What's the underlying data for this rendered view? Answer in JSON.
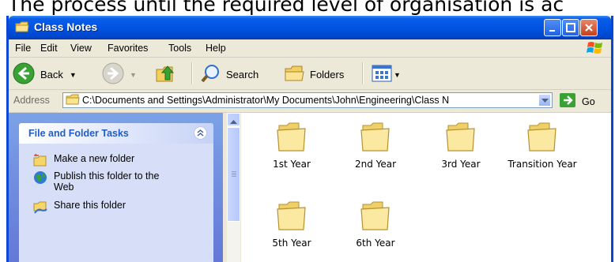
{
  "caption": "The process until the required level of organisation is ac",
  "window": {
    "title": "Class Notes",
    "colors": {
      "titlebar": "#0054e3",
      "taskpane": "#6f8ee0",
      "accent": "#215dc6"
    }
  },
  "menubar": {
    "items": [
      "File",
      "Edit",
      "View",
      "Favorites",
      "Tools",
      "Help"
    ]
  },
  "toolbar": {
    "back_label": "Back",
    "search_label": "Search",
    "folders_label": "Folders"
  },
  "address": {
    "label": "Address",
    "path": "C:\\Documents and Settings\\Administrator\\My Documents\\John\\Engineering\\Class N",
    "go_label": "Go"
  },
  "tasks": {
    "title": "File and Folder Tasks",
    "items": [
      {
        "label": "Make a new folder",
        "icon": "new-folder-icon"
      },
      {
        "label": "Publish this folder to the Web",
        "icon": "publish-web-icon"
      },
      {
        "label": "Share this folder",
        "icon": "share-folder-icon"
      }
    ]
  },
  "folders": [
    {
      "name": "1st Year"
    },
    {
      "name": "2nd Year"
    },
    {
      "name": "3rd Year"
    },
    {
      "name": "Transition Year"
    },
    {
      "name": "5th Year"
    },
    {
      "name": "6th Year"
    }
  ]
}
